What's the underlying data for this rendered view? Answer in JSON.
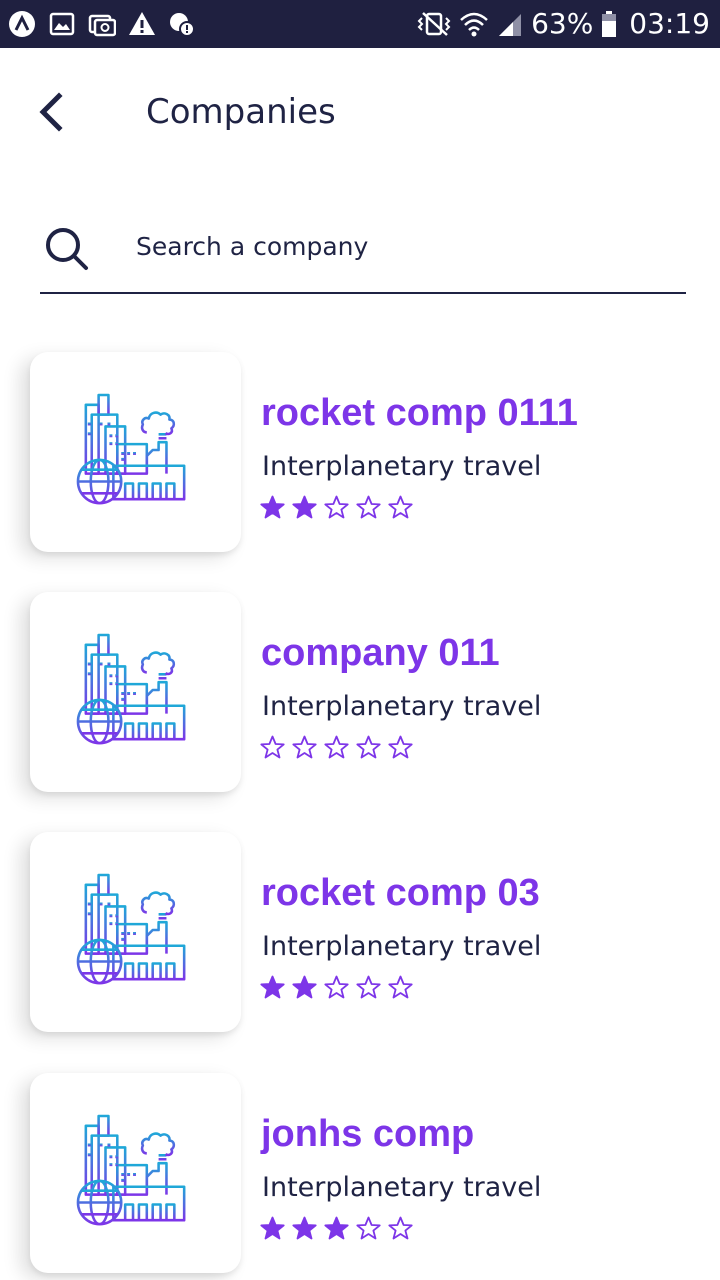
{
  "status_bar": {
    "battery_percent": "63%",
    "time": "03:19"
  },
  "header": {
    "title": "Companies",
    "back_icon": "chevron-left-icon"
  },
  "search": {
    "placeholder": "Search a company",
    "value": "",
    "icon": "search-icon"
  },
  "colors": {
    "accent": "#7d35e8",
    "text_dark": "#1f2344",
    "status_bar": "#1f2040"
  },
  "companies": [
    {
      "name": "rocket comp 0111",
      "category": "Interplanetary travel",
      "rating": 2,
      "max_rating": 5
    },
    {
      "name": "company 011",
      "category": "Interplanetary travel",
      "rating": 0,
      "max_rating": 5
    },
    {
      "name": "rocket comp 03",
      "category": "Interplanetary travel",
      "rating": 2,
      "max_rating": 5
    },
    {
      "name": "jonhs comp",
      "category": "Interplanetary travel",
      "rating": 3,
      "max_rating": 5
    }
  ]
}
